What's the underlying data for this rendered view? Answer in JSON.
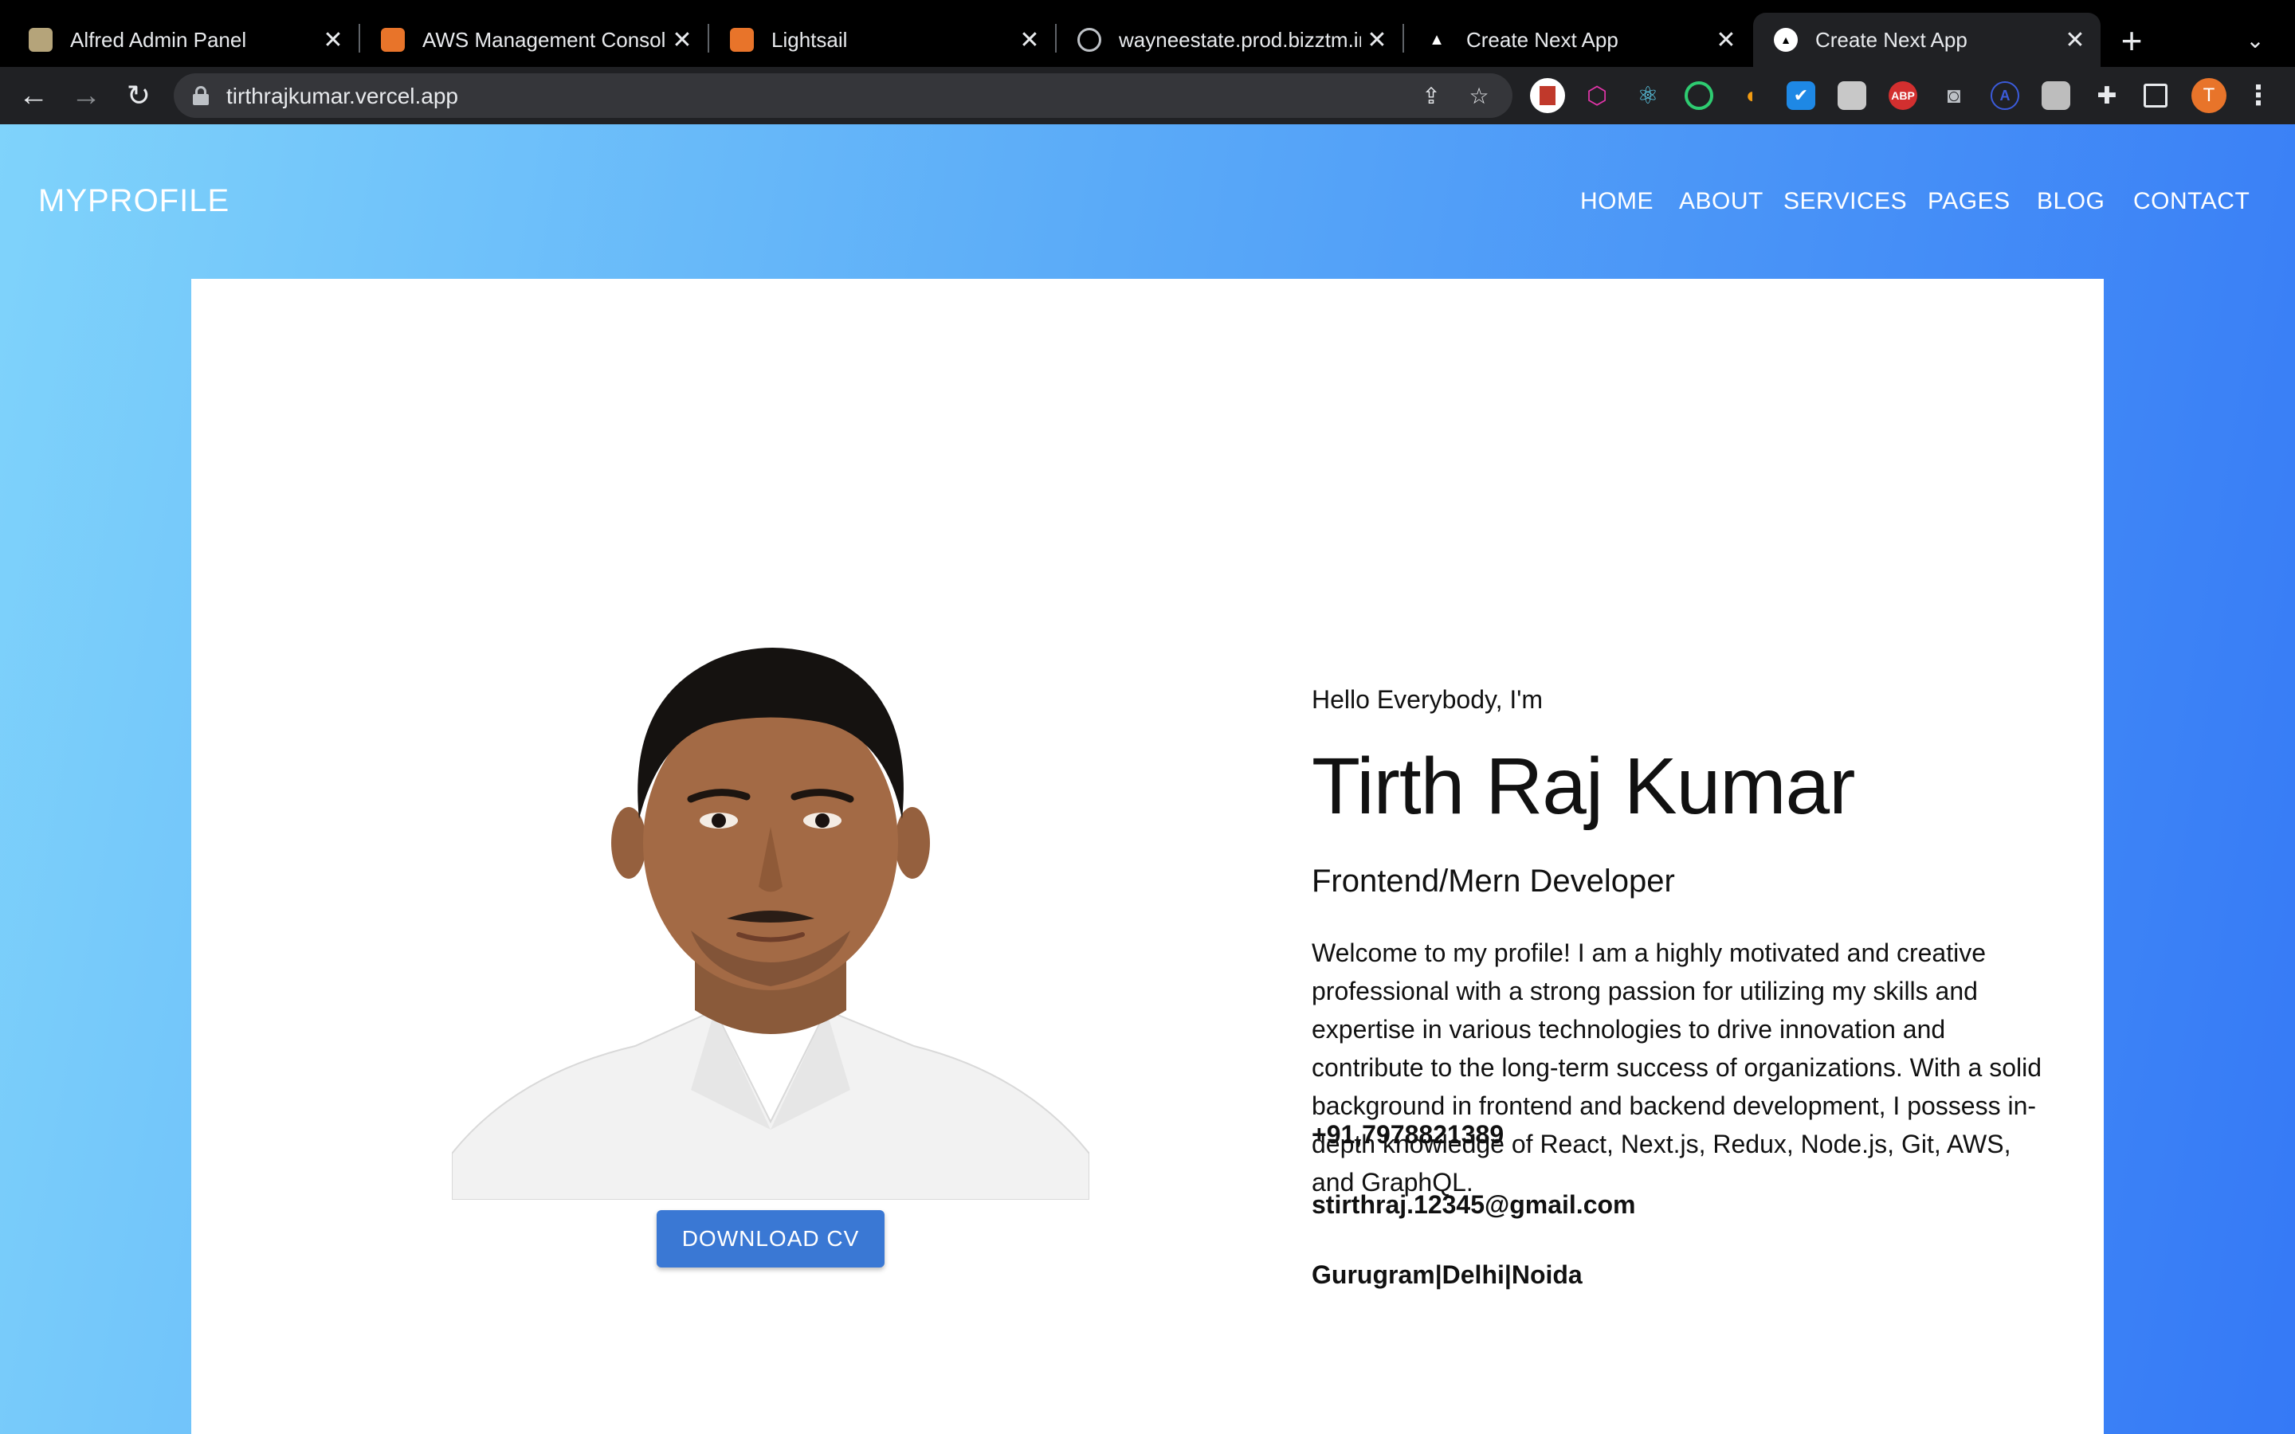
{
  "browser": {
    "tabs": [
      {
        "title": "Alfred Admin Panel",
        "icon": "alfred-favicon",
        "active": false
      },
      {
        "title": "AWS Management Console",
        "icon": "aws-favicon",
        "active": false
      },
      {
        "title": "Lightsail",
        "icon": "lightsail-favicon",
        "active": false
      },
      {
        "title": "wayneestate.prod.bizztm.in",
        "icon": "globe-icon",
        "active": false
      },
      {
        "title": "Create Next App",
        "icon": "vercel-triangle-icon",
        "active": false
      },
      {
        "title": "Create Next App",
        "icon": "vercel-triangle-icon",
        "active": true
      }
    ],
    "url": "tirthrajkumar.vercel.app",
    "profile_initial": "T",
    "extensions": [
      "bookmark",
      "graphql",
      "react-devtools",
      "record",
      "moon",
      "todo",
      "gray-box",
      "ABP",
      "camera",
      "A",
      "touch",
      "puzzle",
      "sidebar"
    ]
  },
  "site": {
    "brand": "MYPROFILE",
    "nav": [
      "HOME",
      "ABOUT",
      "SERVICES",
      "PAGES",
      "BLOG",
      "CONTACT"
    ],
    "greeting": "Hello Everybody, I'm",
    "name": "Tirth Raj Kumar",
    "role": "Frontend/Mern Developer",
    "bio": "Welcome to my profile! I am a highly motivated and creative professional with a strong passion for utilizing my skills and expertise in various technologies to drive innovation and contribute to the long-term success of organizations. With a solid background in frontend and backend development, I possess in-depth knowledge of React, Next.js, Redux, Node.js, Git, AWS, and GraphQL.",
    "phone": "+91,7978821389",
    "email": "stirthraj.12345@gmail.com",
    "location": "Gurugram|Delhi|Noida",
    "cv_button": "DOWNLOAD CV"
  },
  "colors": {
    "gradient_start": "#7fd3fb",
    "gradient_end": "#3579f6",
    "button": "#3a78d4"
  }
}
